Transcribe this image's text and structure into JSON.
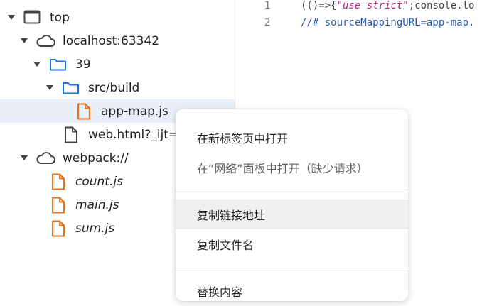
{
  "tree": {
    "items": [
      {
        "label": "top",
        "icon": "frame-icon"
      },
      {
        "label": "localhost:63342",
        "icon": "cloud-icon"
      },
      {
        "label": "39",
        "icon": "folder-icon"
      },
      {
        "label": "src/build",
        "icon": "folder-icon"
      },
      {
        "label": "app-map.js",
        "icon": "file-icon"
      },
      {
        "label": "web.html?_ijt=",
        "icon": "file-icon"
      },
      {
        "label": "webpack://",
        "icon": "cloud-icon"
      },
      {
        "label": "count.js",
        "icon": "file-icon"
      },
      {
        "label": "main.js",
        "icon": "file-icon"
      },
      {
        "label": "sum.js",
        "icon": "file-icon"
      }
    ]
  },
  "editor": {
    "lines": [
      {
        "num": "1",
        "p1": "(()=>{",
        "s": "\"use strict\"",
        "p2": ";console.lo"
      },
      {
        "num": "2",
        "comment": "//# sourceMappingURL=app-map."
      }
    ]
  },
  "context_menu": {
    "items": [
      {
        "label": "在新标签页中打开"
      },
      {
        "label": "在“网络”面板中打开（缺少请求）"
      },
      {
        "label": "复制链接地址"
      },
      {
        "label": "复制文件名"
      },
      {
        "label": "替换内容"
      }
    ]
  },
  "colors": {
    "folder": "#1a73e8",
    "js_file": "#e8711a",
    "selection": "#e9eef8"
  }
}
